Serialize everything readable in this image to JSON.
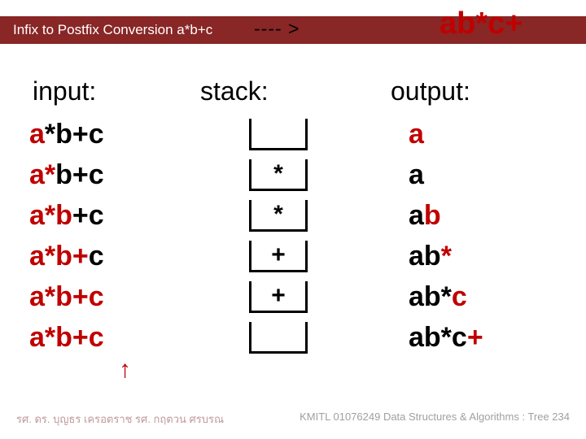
{
  "header": {
    "title": "Infix to Postfix Conversion  a*b+c",
    "arrow": "---- >",
    "result": "ab*c+"
  },
  "columns": {
    "input": "input:",
    "stack": "stack:",
    "output": "output:"
  },
  "rows": [
    {
      "input_red": "a",
      "input_black": "*b+c",
      "stack": "",
      "output_black": "",
      "output_red": "a"
    },
    {
      "input_red": "a*",
      "input_black": "b+c",
      "stack": "*",
      "output_black": "a",
      "output_red": ""
    },
    {
      "input_red": "a*b",
      "input_black": "+c",
      "stack": "*",
      "output_black": "a",
      "output_red": "b"
    },
    {
      "input_red": "a*b+",
      "input_black": "c",
      "stack": "+",
      "output_black": "ab",
      "output_red": "*"
    },
    {
      "input_red": "a*b+c",
      "input_black": "",
      "stack": "+",
      "output_black": "ab*",
      "output_red": "c"
    },
    {
      "input_red": "a*b+c",
      "input_black": "",
      "stack": "",
      "output_black": "ab*c",
      "output_red": "+"
    }
  ],
  "arrow_up": "↑",
  "footer": {
    "left": "รศ. ดร. บุญธร    เครอตราช    รศ. กฤตวน  ศรบรณ",
    "right": "KMITL   01076249 Data Structures & Algorithms : Tree 234"
  },
  "chart_data": {
    "type": "table",
    "title": "Infix to Postfix Conversion a*b+c → ab*c+",
    "columns": [
      "input",
      "stack",
      "output"
    ],
    "rows": [
      [
        "a*b+c",
        "",
        "a"
      ],
      [
        "a*b+c",
        "*",
        "a"
      ],
      [
        "a*b+c",
        "*",
        "ab"
      ],
      [
        "a*b+c",
        "+",
        "ab*"
      ],
      [
        "a*b+c",
        "+",
        "ab*c"
      ],
      [
        "a*b+c",
        "",
        "ab*c+"
      ]
    ]
  }
}
